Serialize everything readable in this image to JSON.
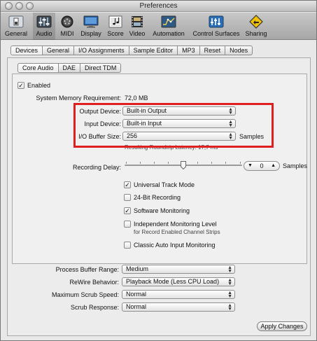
{
  "window": {
    "title": "Preferences"
  },
  "toolbar": {
    "items": [
      {
        "label": "General",
        "icon": "general-switch-icon"
      },
      {
        "label": "Audio",
        "icon": "audio-fader-icon"
      },
      {
        "label": "MIDI",
        "icon": "midi-port-icon"
      },
      {
        "label": "Display",
        "icon": "display-monitor-icon"
      },
      {
        "label": "Score",
        "icon": "score-notes-icon"
      },
      {
        "label": "Video",
        "icon": "video-filmstrip-icon"
      },
      {
        "label": "Automation",
        "icon": "automation-curve-icon"
      },
      {
        "label": "Control Surfaces",
        "icon": "control-surfaces-icon"
      },
      {
        "label": "Sharing",
        "icon": "sharing-icon"
      }
    ],
    "selected": "Audio"
  },
  "tabs": [
    "Devices",
    "General",
    "I/O Assignments",
    "Sample Editor",
    "MP3",
    "Reset",
    "Nodes"
  ],
  "selected_tab": "Devices",
  "subtabs": [
    "Core Audio",
    "DAE",
    "Direct TDM"
  ],
  "selected_subtab": "Core Audio",
  "core_audio": {
    "enabled_label": "Enabled",
    "enabled": true,
    "memory_label": "System Memory Requirement:",
    "memory_value": "72,0 MB",
    "output_device_label": "Output Device:",
    "output_device_value": "Built-in Output",
    "input_device_label": "Input Device:",
    "input_device_value": "Built-in Input",
    "buffer_size_label": "I/O Buffer Size:",
    "buffer_size_value": "256",
    "buffer_size_unit": "Samples",
    "roundtrip_label": "Resulting Roundtrip Latency: 17,7 ms",
    "recording_delay_label": "Recording Delay:",
    "recording_delay_value": "0",
    "recording_delay_unit": "Samples",
    "recording_delay_slider_fraction": 0.5,
    "options": [
      {
        "label": "Universal Track Mode",
        "checked": true
      },
      {
        "label": "24-Bit Recording",
        "checked": false
      },
      {
        "label": "Software Monitoring",
        "checked": true
      },
      {
        "label": "Independent Monitoring Level",
        "sublabel": "for Record Enabled Channel Strips",
        "checked": false
      },
      {
        "label": "Classic Auto Input Monitoring",
        "checked": false
      }
    ]
  },
  "global": {
    "process_buffer_label": "Process Buffer Range:",
    "process_buffer_value": "Medium",
    "rewire_label": "ReWire Behavior:",
    "rewire_value": "Playback Mode (Less CPU Load)",
    "scrub_speed_label": "Maximum Scrub Speed:",
    "scrub_speed_value": "Normal",
    "scrub_response_label": "Scrub Response:",
    "scrub_response_value": "Normal"
  },
  "apply_button_label": "Apply Changes",
  "highlight_color": "#e02020"
}
